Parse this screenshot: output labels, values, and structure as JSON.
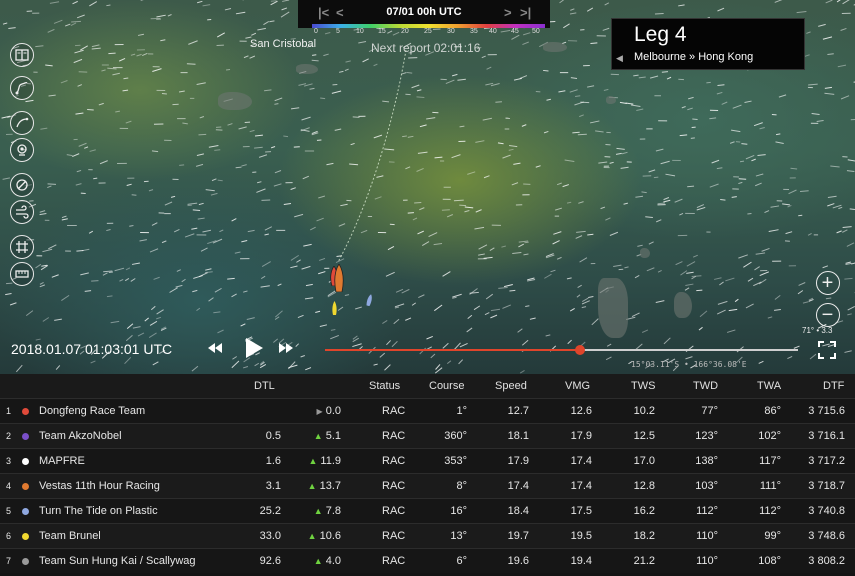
{
  "timebar": {
    "label": "07/01 00h UTC",
    "first_icon": "skip-first-icon",
    "prev_icon": "step-back-icon",
    "next_icon": "step-forward-icon",
    "last_icon": "skip-last-icon",
    "scale_ticks": [
      "0",
      "5",
      "10",
      "15",
      "20",
      "25",
      "30",
      "35",
      "40",
      "45",
      "50"
    ]
  },
  "map": {
    "place_label": "San Cristobal",
    "next_report": "Next report 02:01:16",
    "coords": "15°03.11'S • 166°36.08'E",
    "zoom_readout": "71° • 3.3"
  },
  "leg": {
    "title": "Leg 4",
    "route": "Melbourne » Hong Kong",
    "arrow_icon": "caret-left-icon"
  },
  "tools": [
    {
      "name": "rankings-icon"
    },
    {
      "name": "route-icon"
    },
    {
      "name": "zoom-fit-icon"
    },
    {
      "name": "camera-icon"
    },
    {
      "name": "layer-toggle-icon"
    },
    {
      "name": "wind-layer-icon"
    },
    {
      "name": "grid-icon"
    },
    {
      "name": "ruler-icon"
    }
  ],
  "playback": {
    "datetime": "2018.01.07 01:03:01 UTC",
    "progress": 0.54
  },
  "colors": {
    "accent": "#e0452b",
    "positive": "#6fd240"
  },
  "table": {
    "headers": {
      "dtl": "DTL",
      "status": "Status",
      "course": "Course",
      "speed": "Speed",
      "vmg": "VMG",
      "tws": "TWS",
      "twd": "TWD",
      "twa": "TWA",
      "dtf": "DTF"
    },
    "rows": [
      {
        "rank": "1",
        "color": "#e04a3a",
        "name": "Dongfeng Race Team",
        "dtl": "",
        "change_icon": "flat",
        "change": "0.0",
        "status": "RAC",
        "course": "1°",
        "speed": "12.7",
        "vmg": "12.6",
        "tws": "10.2",
        "twd": "77°",
        "twa": "86°",
        "dtf": "3 715.6"
      },
      {
        "rank": "2",
        "color": "#7a4fc9",
        "name": "Team AkzoNobel",
        "dtl": "0.5",
        "change_icon": "up",
        "change": "5.1",
        "status": "RAC",
        "course": "360°",
        "speed": "18.1",
        "vmg": "17.9",
        "tws": "12.5",
        "twd": "123°",
        "twa": "102°",
        "dtf": "3 716.1"
      },
      {
        "rank": "3",
        "color": "#ffffff",
        "name": "MAPFRE",
        "dtl": "1.6",
        "change_icon": "up",
        "change": "11.9",
        "status": "RAC",
        "course": "353°",
        "speed": "17.9",
        "vmg": "17.4",
        "tws": "17.0",
        "twd": "138°",
        "twa": "117°",
        "dtf": "3 717.2"
      },
      {
        "rank": "4",
        "color": "#e07a30",
        "name": "Vestas 11th Hour Racing",
        "dtl": "3.1",
        "change_icon": "up",
        "change": "13.7",
        "status": "RAC",
        "course": "8°",
        "speed": "17.4",
        "vmg": "17.4",
        "tws": "12.8",
        "twd": "103°",
        "twa": "111°",
        "dtf": "3 718.7"
      },
      {
        "rank": "5",
        "color": "#8fa8e0",
        "name": "Turn The Tide on Plastic",
        "dtl": "25.2",
        "change_icon": "up",
        "change": "7.8",
        "status": "RAC",
        "course": "16°",
        "speed": "18.4",
        "vmg": "17.5",
        "tws": "16.2",
        "twd": "112°",
        "twa": "112°",
        "dtf": "3 740.8"
      },
      {
        "rank": "6",
        "color": "#f0d830",
        "name": "Team Brunel",
        "dtl": "33.0",
        "change_icon": "up",
        "change": "10.6",
        "status": "RAC",
        "course": "13°",
        "speed": "19.7",
        "vmg": "19.5",
        "tws": "18.2",
        "twd": "110°",
        "twa": "99°",
        "dtf": "3 748.6"
      },
      {
        "rank": "7",
        "color": "#9a9a9a",
        "name": "Team Sun Hung Kai / Scallywag",
        "dtl": "92.6",
        "change_icon": "up",
        "change": "4.0",
        "status": "RAC",
        "course": "6°",
        "speed": "19.6",
        "vmg": "19.4",
        "tws": "21.2",
        "twd": "110°",
        "twa": "108°",
        "dtf": "3 808.2"
      }
    ]
  }
}
